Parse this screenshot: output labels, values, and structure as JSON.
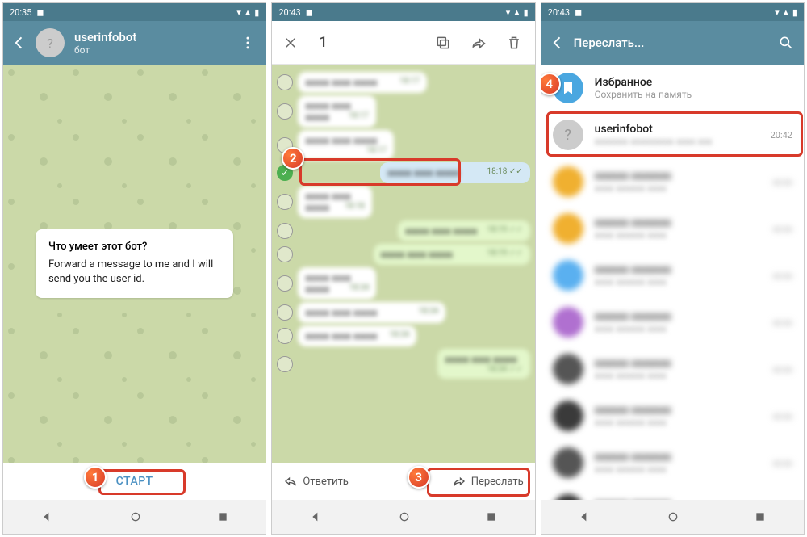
{
  "status": {
    "times": [
      "20:35",
      "20:43",
      "20:43"
    ]
  },
  "screen1": {
    "header": {
      "title": "userinfobot",
      "subtitle": "бот"
    },
    "card": {
      "question": "Что умеет этот бот?",
      "answer": "Forward a message to me and I will send you the user id."
    },
    "start": "СТАРТ"
  },
  "screen2": {
    "selected_count": "1",
    "messages": [
      {
        "dir": "in",
        "time": "18:17"
      },
      {
        "dir": "in",
        "time": "18:17"
      },
      {
        "dir": "in",
        "time": "18:17"
      },
      {
        "dir": "out",
        "time": "18:18",
        "selected": true
      },
      {
        "dir": "in",
        "time": "18:18"
      },
      {
        "dir": "out",
        "time": "18:19"
      },
      {
        "dir": "out",
        "time": "18:19"
      },
      {
        "dir": "in",
        "time": "18:34"
      },
      {
        "dir": "in",
        "time": "18:34"
      },
      {
        "dir": "in",
        "time": "18:34"
      },
      {
        "dir": "out",
        "time": "18:34"
      }
    ],
    "reply": "Ответить",
    "forward": "Переслать"
  },
  "screen3": {
    "title": "Переслать...",
    "saved": {
      "name": "Избранное",
      "sub": "Сохранить на память"
    },
    "userinfobot": {
      "name": "userinfobot",
      "time": "20:42"
    },
    "colors": [
      "#f0b030",
      "#f0b030",
      "#5ab0f0",
      "#b070d0",
      "#555",
      "#3a3a3a",
      "#555",
      "#333"
    ]
  },
  "badges": [
    "1",
    "2",
    "3",
    "4"
  ]
}
